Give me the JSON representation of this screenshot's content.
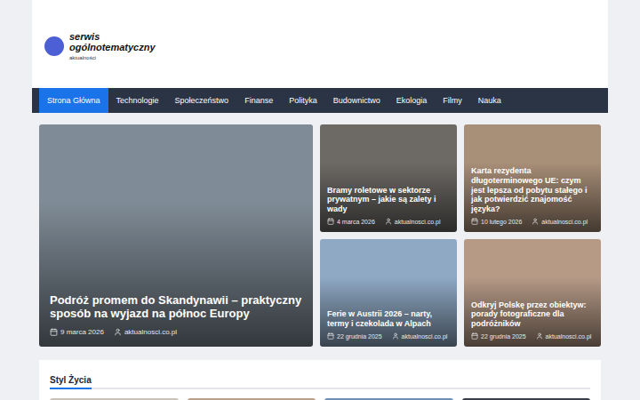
{
  "logo": {
    "title": "serwis ogólnotematyczny",
    "subtitle": "aktualności"
  },
  "nav": [
    {
      "label": "Strona Główna",
      "selected": true
    },
    {
      "label": "Technologie",
      "selected": false
    },
    {
      "label": "Społeczeństwo",
      "selected": false
    },
    {
      "label": "Finanse",
      "selected": false
    },
    {
      "label": "Polityka",
      "selected": false
    },
    {
      "label": "Budownictwo",
      "selected": false
    },
    {
      "label": "Ekologia",
      "selected": false
    },
    {
      "label": "Filmy",
      "selected": false
    },
    {
      "label": "Nauka",
      "selected": false
    }
  ],
  "featured": [
    {
      "title": "Podróż promem do Skandynawii – praktyczny sposób na wyjazd na północ Europy",
      "date": "9 marca 2026",
      "author": "aktualnosci.co.pl",
      "color": "#7f8b96",
      "kind": "large"
    },
    {
      "title": "Bramy roletowe w sektorze prywatnym – jakie są zalety i wady",
      "date": "4 marca 2026",
      "author": "aktualnosci.co.pl",
      "color": "#6d6a66",
      "kind": "small"
    },
    {
      "title": "Karta rezydenta długoterminowego UE: czym jest lepsza od pobytu stałego i jak potwierdzić znajomość języka?",
      "date": "10 lutego 2026",
      "author": "aktualnosci.co.pl",
      "color": "#a88f78",
      "kind": "small"
    },
    {
      "title": "Ferie w Austrii 2026 – narty, termy i czekolada w Alpach",
      "date": "22 grudnia 2025",
      "author": "aktualnosci.co.pl",
      "color": "#8fa9c4",
      "kind": "small"
    },
    {
      "title": "Odkryj Polskę przez obiektyw: porady fotograficzne dla podróżników",
      "date": "22 grudnia 2025",
      "author": "aktualnosci.co.pl",
      "color": "#b69a86",
      "kind": "small"
    }
  ],
  "section": {
    "title": "Styl Życia",
    "cards": [
      {
        "color": "#c9c2b8"
      },
      {
        "color": "#b9a08a"
      },
      {
        "color": "#6f8fb5"
      },
      {
        "color": "#3a3f4a"
      }
    ]
  }
}
